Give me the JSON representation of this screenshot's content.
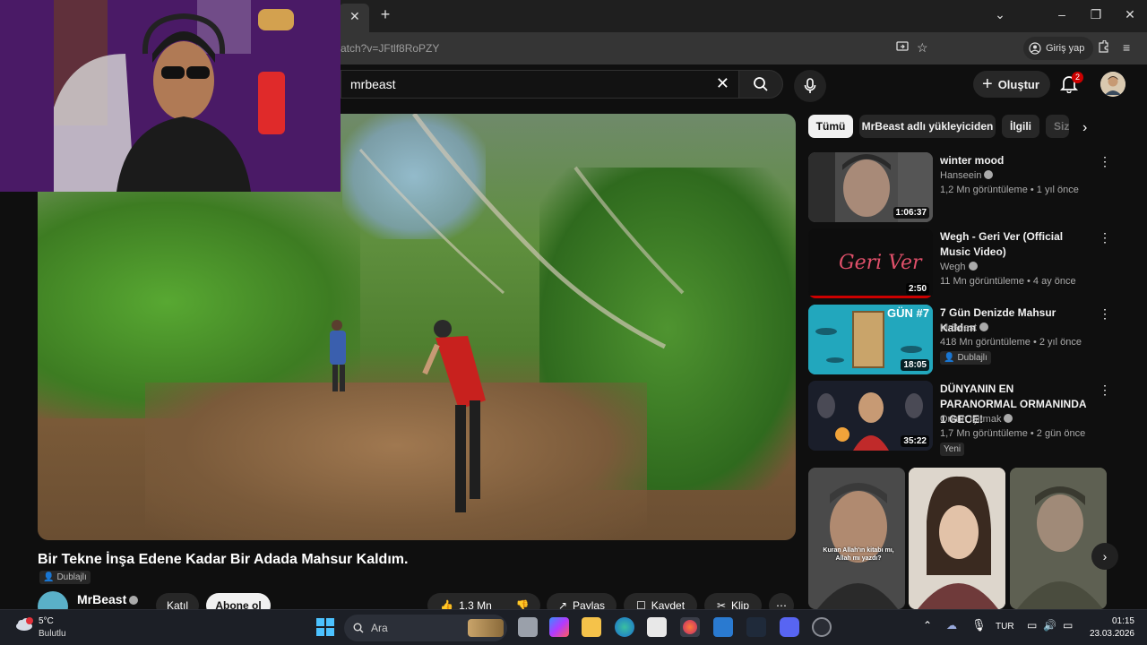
{
  "browser": {
    "url": "atch?v=JFtlf8RoPZY",
    "signin_label": "Giriş yap"
  },
  "header": {
    "search_value": "mrbeast",
    "create_label": "Oluştur",
    "notification_count": "2"
  },
  "video": {
    "title": "Bir Tekne İnşa Edene Kadar Bir Adada Mahsur Kaldım.",
    "dubbed_label": "Dublajlı",
    "channel": "MrBeast",
    "join_label": "Katıl",
    "subscribe_label": "Abone ol",
    "likes": "1.3 Mn",
    "share_label": "Paylaş",
    "save_label": "Kaydet",
    "clip_label": "Klip"
  },
  "chips": [
    "Tümü",
    "MrBeast adlı yükleyiciden",
    "İlgili",
    "Siz"
  ],
  "recommendations": [
    {
      "title": "winter mood",
      "channel": "Hanseein",
      "meta": "1,2 Mn görüntüleme • 1 yıl önce",
      "duration": "1:06:37",
      "badge": ""
    },
    {
      "title": "Wegh - Geri Ver (Official Music Video)",
      "channel": "Wegh",
      "meta": "11 Mn görüntüleme • 4 ay önce",
      "duration": "2:50",
      "badge": "",
      "thumb_text": "Geri Ver"
    },
    {
      "title": "7 Gün Denizde Mahsur Kaldım",
      "channel": "MrBeast",
      "meta": "418 Mn görüntüleme • 2 yıl önce",
      "duration": "18:05",
      "badge": "Dublajlı",
      "thumb_text": "GÜN #7"
    },
    {
      "title": "DÜNYANIN EN PARANORMAL ORMANINDA 1 GECE!",
      "channel": "Orkun Işıtmak",
      "meta": "1,7 Mn görüntüleme • 2 gün önce",
      "duration": "35:22",
      "badge": "Yeni"
    }
  ],
  "shorts": [
    {
      "caption": "Kuran Allah'ın kitabı mı, Allah mı yazdı?"
    },
    {
      "caption": ""
    },
    {
      "caption": ""
    }
  ],
  "taskbar": {
    "temperature": "5°C",
    "weather": "Bulutlu",
    "search_placeholder": "Ara",
    "language": "TUR",
    "time": "01:15",
    "date": "23.03.2026"
  },
  "colors": {
    "background": "#0f0f0f",
    "accent_red": "#cc0000",
    "webcam_purple": "#7a2fa0"
  }
}
